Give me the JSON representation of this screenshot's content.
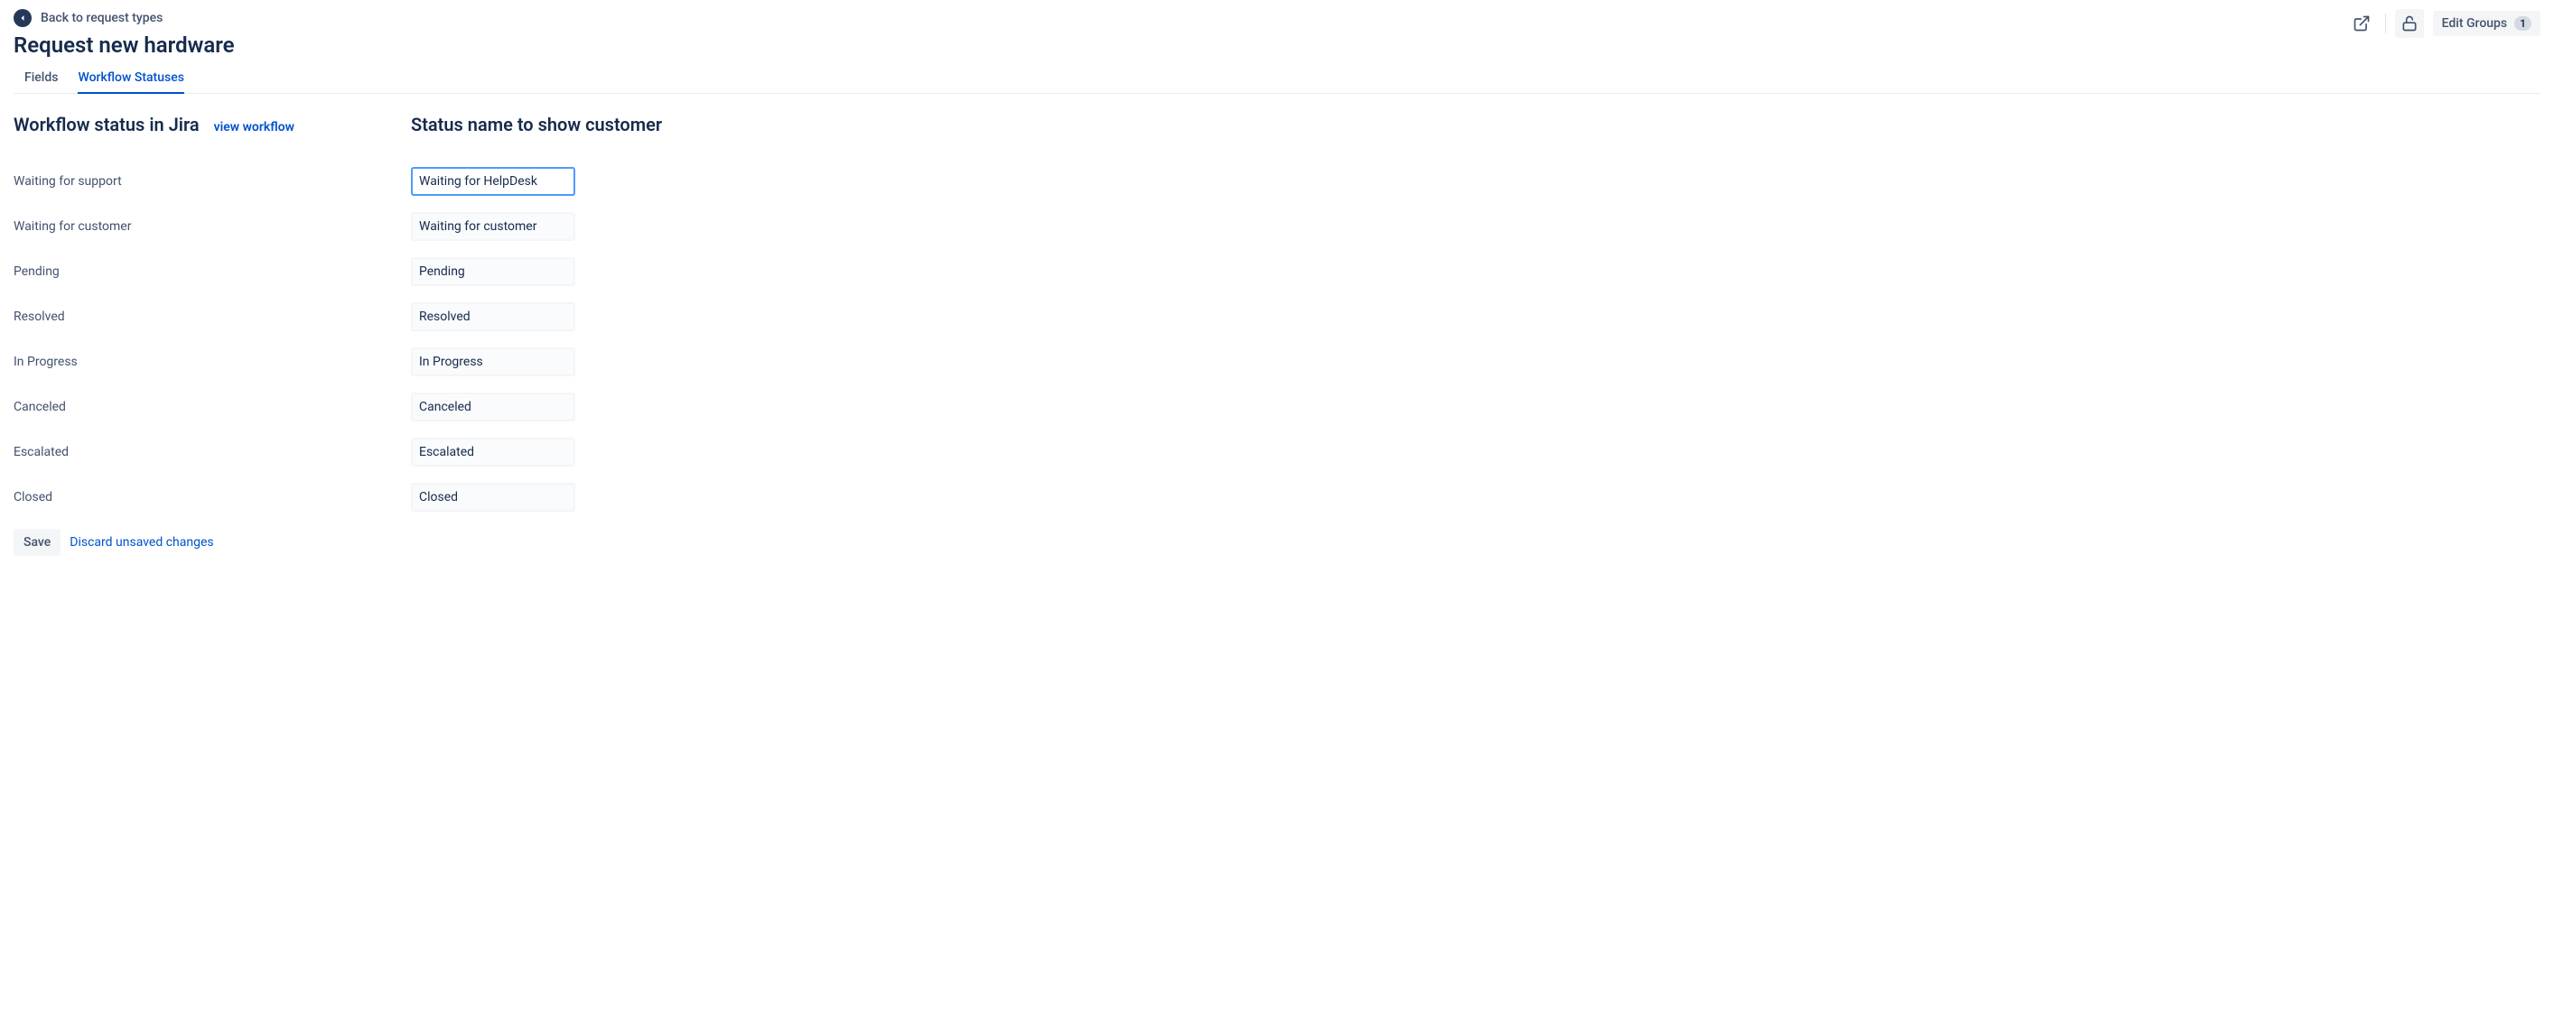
{
  "header": {
    "back_label": "Back to request types",
    "title": "Request new hardware",
    "edit_groups_label": "Edit Groups",
    "edit_groups_count": "1"
  },
  "tabs": [
    {
      "label": "Fields",
      "active": false
    },
    {
      "label": "Workflow Statuses",
      "active": true
    }
  ],
  "columns": {
    "left_heading": "Workflow status in Jira",
    "view_workflow_label": "view workflow",
    "right_heading": "Status name to show customer"
  },
  "statuses": [
    {
      "jira": "Waiting for support",
      "customer": "Waiting for HelpDesk",
      "focused": true
    },
    {
      "jira": "Waiting for customer",
      "customer": "Waiting for customer",
      "focused": false
    },
    {
      "jira": "Pending",
      "customer": "Pending",
      "focused": false
    },
    {
      "jira": "Resolved",
      "customer": "Resolved",
      "focused": false
    },
    {
      "jira": "In Progress",
      "customer": "In Progress",
      "focused": false
    },
    {
      "jira": "Canceled",
      "customer": "Canceled",
      "focused": false
    },
    {
      "jira": "Escalated",
      "customer": "Escalated",
      "focused": false
    },
    {
      "jira": "Closed",
      "customer": "Closed",
      "focused": false
    }
  ],
  "actions": {
    "save_label": "Save",
    "discard_label": "Discard unsaved changes"
  }
}
